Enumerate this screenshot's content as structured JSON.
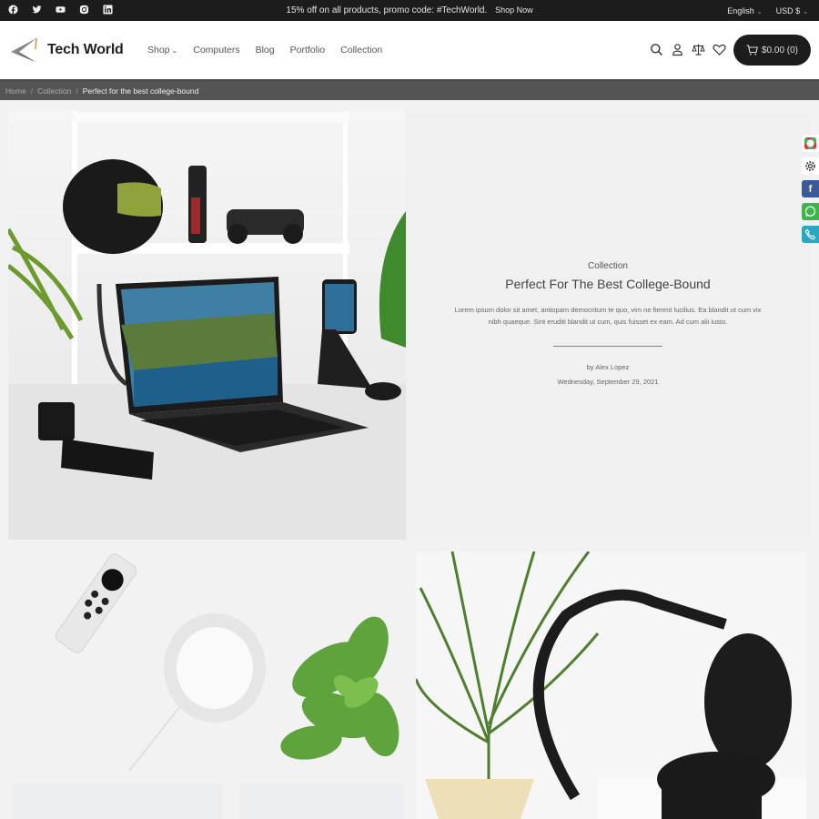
{
  "topbar": {
    "socials": [
      "facebook-icon",
      "twitter-icon",
      "youtube-icon",
      "instagram-icon",
      "linkedin-icon"
    ],
    "promo_text": "15% off on all products, promo code: #TechWorld.",
    "promo_link": "Shop Now",
    "language": "English",
    "currency": "USD $"
  },
  "header": {
    "brand": "Tech World",
    "nav": [
      {
        "label": "Shop",
        "has_dropdown": true
      },
      {
        "label": "Computers"
      },
      {
        "label": "Blog"
      },
      {
        "label": "Portfolio"
      },
      {
        "label": "Collection"
      }
    ],
    "icons": [
      "search-icon",
      "user-icon",
      "compare-icon",
      "wishlist-icon"
    ],
    "cart_label": "$0.00 (0)"
  },
  "breadcrumb": {
    "items": [
      "Home",
      "Collection"
    ],
    "current": "Perfect for the best college-bound"
  },
  "article": {
    "category": "Collection",
    "title": "Perfect For The Best College-Bound",
    "description": "Lorem ipsum dolor sit amet, antiopam democritum te quo, vim ne fierent lucilius. Ea blandit ut cum vix nibh quaeque. Sint eruditi blandit ut cum, quis fuisset ex eam. Ad cum alii iusto.",
    "author": "by Alex Lopez",
    "date": "Wednesday, September 29, 2021"
  },
  "images": {
    "hero": "Laptop and phone on white desk with shelves",
    "tile1": "Remote, smart speaker and succulent",
    "tile2": "Black headphones on stand with plant",
    "tile3": "Gallery image",
    "tile4": "Gallery image"
  },
  "floating": [
    "color-picker-icon",
    "settings-icon",
    "facebook-icon",
    "whatsapp-icon",
    "phone-icon"
  ],
  "colors": {
    "topbar_bg": "#1c1c1c",
    "breadcrumb_bg": "#555555",
    "page_bg": "#f2f2f2",
    "facebook": "#3b5998",
    "whatsapp": "#3bb54a",
    "phone": "#2aa8bf"
  }
}
